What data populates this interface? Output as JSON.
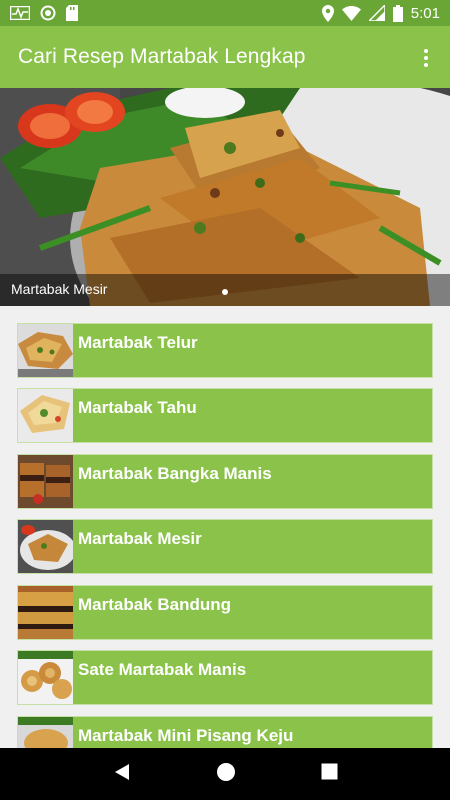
{
  "status_bar": {
    "time": "5:01",
    "icons": [
      "activity-icon",
      "circle-icon",
      "sd-card-icon",
      "location-icon",
      "wifi-icon",
      "signal-icon",
      "battery-icon"
    ]
  },
  "app_bar": {
    "title": "Cari Resep Martabak Lengkap",
    "menu_icon": "more-vert-icon"
  },
  "banner": {
    "caption": "Martabak Mesir",
    "slide_count": 1,
    "active_slide": 1
  },
  "recipes": [
    {
      "label": "Martabak Telur"
    },
    {
      "label": "Martabak Tahu"
    },
    {
      "label": "Martabak Bangka Manis"
    },
    {
      "label": "Martabak Mesir"
    },
    {
      "label": "Martabak Bandung"
    },
    {
      "label": "Sate Martabak Manis"
    },
    {
      "label": "Martabak Mini Pisang Keju"
    }
  ],
  "colors": {
    "status_bar": "#69a636",
    "app_bar": "#8bc34a",
    "item_bg": "#8bc34a",
    "list_bg": "#f0f0f0"
  },
  "nav_bar": {
    "icons": [
      "back-icon",
      "home-icon",
      "recents-icon"
    ]
  }
}
